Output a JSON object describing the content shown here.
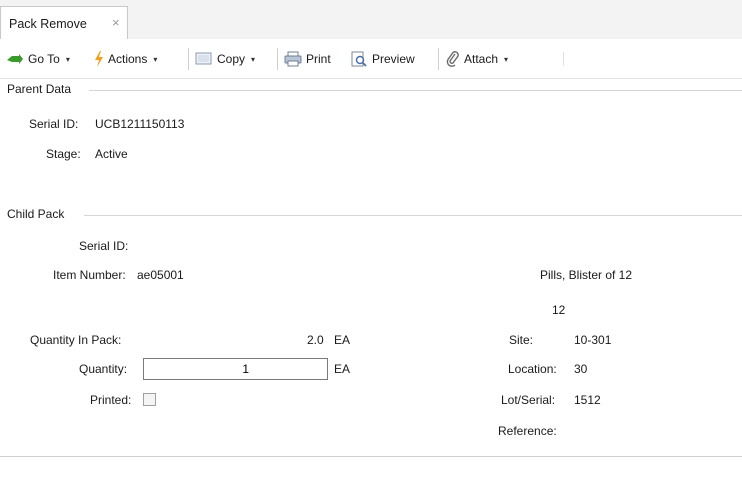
{
  "tab": {
    "title": "Pack Remove",
    "close": "×"
  },
  "toolbar": {
    "goto_label": "Go To",
    "actions_label": "Actions",
    "copy_label": "Copy",
    "print_label": "Print",
    "preview_label": "Preview",
    "attach_label": "Attach",
    "caret": "▾"
  },
  "parent": {
    "title": "Parent Data",
    "serial_label": "Serial ID:",
    "serial_value": "UCB1211150113",
    "stage_label": "Stage:",
    "stage_value": "Active"
  },
  "child": {
    "title": "Child Pack",
    "serial_label": "Serial ID:",
    "item_label": "Item Number:",
    "item_value": "ae05001",
    "item_description": "Pills, Blister of 12",
    "pack_size": "12",
    "qty_in_pack_label": "Quantity In Pack:",
    "qty_in_pack_value": "2.0",
    "qty_in_pack_uom": "EA",
    "quantity_label": "Quantity:",
    "quantity_value": "1",
    "quantity_uom": "EA",
    "printed_label": "Printed:",
    "printed_checked": false,
    "site_label": "Site:",
    "site_value": "10-301",
    "location_label": "Location:",
    "location_value": "30",
    "lot_label": "Lot/Serial:",
    "lot_value": "1512",
    "reference_label": "Reference:"
  },
  "colors": {
    "goto_icon": "#3a9a2a",
    "actions_icon": "#f0a020",
    "accent_line": "#d6d6d6"
  }
}
